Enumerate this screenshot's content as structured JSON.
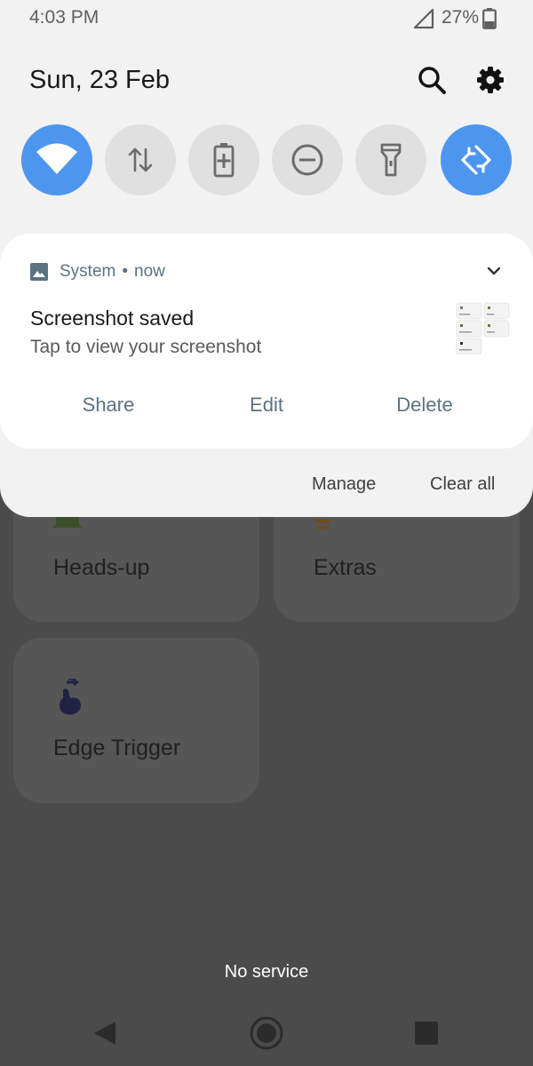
{
  "status_bar": {
    "time": "4:03 PM",
    "battery_percent": "27%",
    "signal_icon": "signal-empty-icon",
    "battery_icon": "battery-icon"
  },
  "header": {
    "date": "Sun, 23 Feb",
    "search_icon": "search-icon",
    "settings_icon": "gear-icon"
  },
  "quick_settings": [
    {
      "name": "wifi",
      "icon": "wifi-icon",
      "active": true
    },
    {
      "name": "mobile-data",
      "icon": "data-arrows-icon",
      "active": false
    },
    {
      "name": "battery-saver",
      "icon": "battery-saver-icon",
      "active": false
    },
    {
      "name": "do-not-disturb",
      "icon": "do-not-disturb-icon",
      "active": false
    },
    {
      "name": "flashlight",
      "icon": "flashlight-icon",
      "active": false
    },
    {
      "name": "auto-rotate",
      "icon": "auto-rotate-icon",
      "active": true
    }
  ],
  "notification": {
    "app_name": "System",
    "separator": "•",
    "time": "now",
    "title": "Screenshot saved",
    "text": "Tap to view your screenshot",
    "actions": [
      "Share",
      "Edit",
      "Delete"
    ]
  },
  "shade_footer": {
    "manage_label": "Manage",
    "clear_all_label": "Clear all"
  },
  "background_app": {
    "cards": [
      {
        "label": "Heads-up",
        "icon": "bell-icon"
      },
      {
        "label": "Extras",
        "icon": "lightbulb-icon"
      },
      {
        "label": "Edge Trigger",
        "icon": "swipe-finger-icon"
      }
    ],
    "carrier_status": "No service"
  },
  "colors": {
    "accent": "#4d96f0",
    "action_text": "#5b7280",
    "shade_background": "#f2f2f2",
    "scrim": "#4b4b4b"
  }
}
